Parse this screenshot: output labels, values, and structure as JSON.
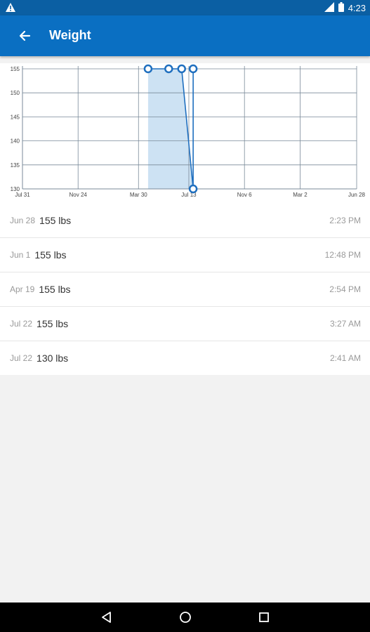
{
  "status_bar": {
    "time": "4:23"
  },
  "header": {
    "title": "Weight"
  },
  "chart_data": {
    "type": "area",
    "x_tick_labels": [
      "Jul 31",
      "Nov 24",
      "Mar 30",
      "Jul 13",
      "Nov 6",
      "Mar 2",
      "Jun 28"
    ],
    "y_tick_labels": [
      "130",
      "135",
      "140",
      "145",
      "150",
      "155"
    ],
    "ylim": [
      130,
      155
    ],
    "grid": true,
    "series": [
      {
        "values": [
          {
            "x": "Jul 22",
            "y": 130
          },
          {
            "x": "Jul 22",
            "y": 155
          },
          {
            "x": "Apr 19",
            "y": 155
          },
          {
            "x": "Jun 1",
            "y": 155
          },
          {
            "x": "Jun 28",
            "y": 155
          }
        ]
      }
    ],
    "colors": {
      "line": "#1f6fbf",
      "fill": "#cde2f3",
      "grid": "#7a8a99"
    }
  },
  "entries": [
    {
      "date": "Jun 28",
      "value": "155 lbs",
      "time": "2:23 PM"
    },
    {
      "date": "Jun 1",
      "value": "155 lbs",
      "time": "12:48 PM"
    },
    {
      "date": "Apr 19",
      "value": "155 lbs",
      "time": "2:54 PM"
    },
    {
      "date": "Jul 22",
      "value": "155 lbs",
      "time": "3:27 AM"
    },
    {
      "date": "Jul 22",
      "value": "130 lbs",
      "time": "2:41 AM"
    }
  ],
  "colors": {
    "appbar": "#0a6fc2",
    "statusbar": "#0b5fa3",
    "accent": "#1f6fbf"
  }
}
